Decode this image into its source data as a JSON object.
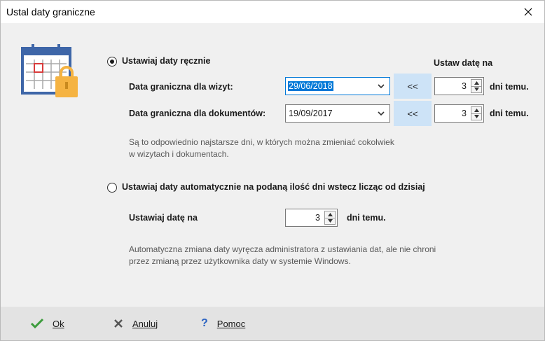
{
  "window": {
    "title": "Ustal daty graniczne"
  },
  "manual": {
    "radio_label": "Ustawiaj daty ręcznie",
    "selected": true,
    "header_set_date": "Ustaw datę na",
    "visit": {
      "label": "Data graniczna dla wizyt:",
      "date": "29/06/2018",
      "back_label": "<<",
      "days": "3",
      "suffix": "dni temu."
    },
    "documents": {
      "label": "Data graniczna dla dokumentów:",
      "date": "19/09/2017",
      "back_label": "<<",
      "days": "3",
      "suffix": "dni temu."
    },
    "note_line1": "Są to odpowiednio najstarsze dni, w których można zmieniać cokolwiek",
    "note_line2": "w wizytach i dokumentach."
  },
  "automatic": {
    "radio_label": "Ustawiaj daty automatycznie na podaną ilość dni wstecz licząc od dzisiaj",
    "selected": false,
    "set_label": "Ustawiaj datę na",
    "days": "3",
    "suffix": "dni temu.",
    "note_line1": "Automatyczna zmiana daty wyręcza administratora z ustawiania dat, ale nie chroni",
    "note_line2": "przez zmianą przez użytkownika daty w systemie Windows."
  },
  "footer": {
    "ok_label": "Ok",
    "cancel_label": "Anuluj",
    "help_label": "Pomoc",
    "help_glyph": "?"
  },
  "icons": {
    "app": "calendar-lock-icon",
    "close": "close-icon",
    "combo_arrow": "chevron-down-icon",
    "spin_up": "spin-up-icon",
    "spin_down": "spin-down-icon",
    "ok": "checkmark-icon",
    "cancel": "x-icon",
    "help": "question-mark-icon"
  },
  "colors": {
    "accent": "#0078d7",
    "back_button": "#cde3f7",
    "lock": "#f5b342",
    "calendar_frame": "#3e66a8",
    "ok_icon": "#3c9c3c",
    "help_icon": "#2a62c2"
  }
}
